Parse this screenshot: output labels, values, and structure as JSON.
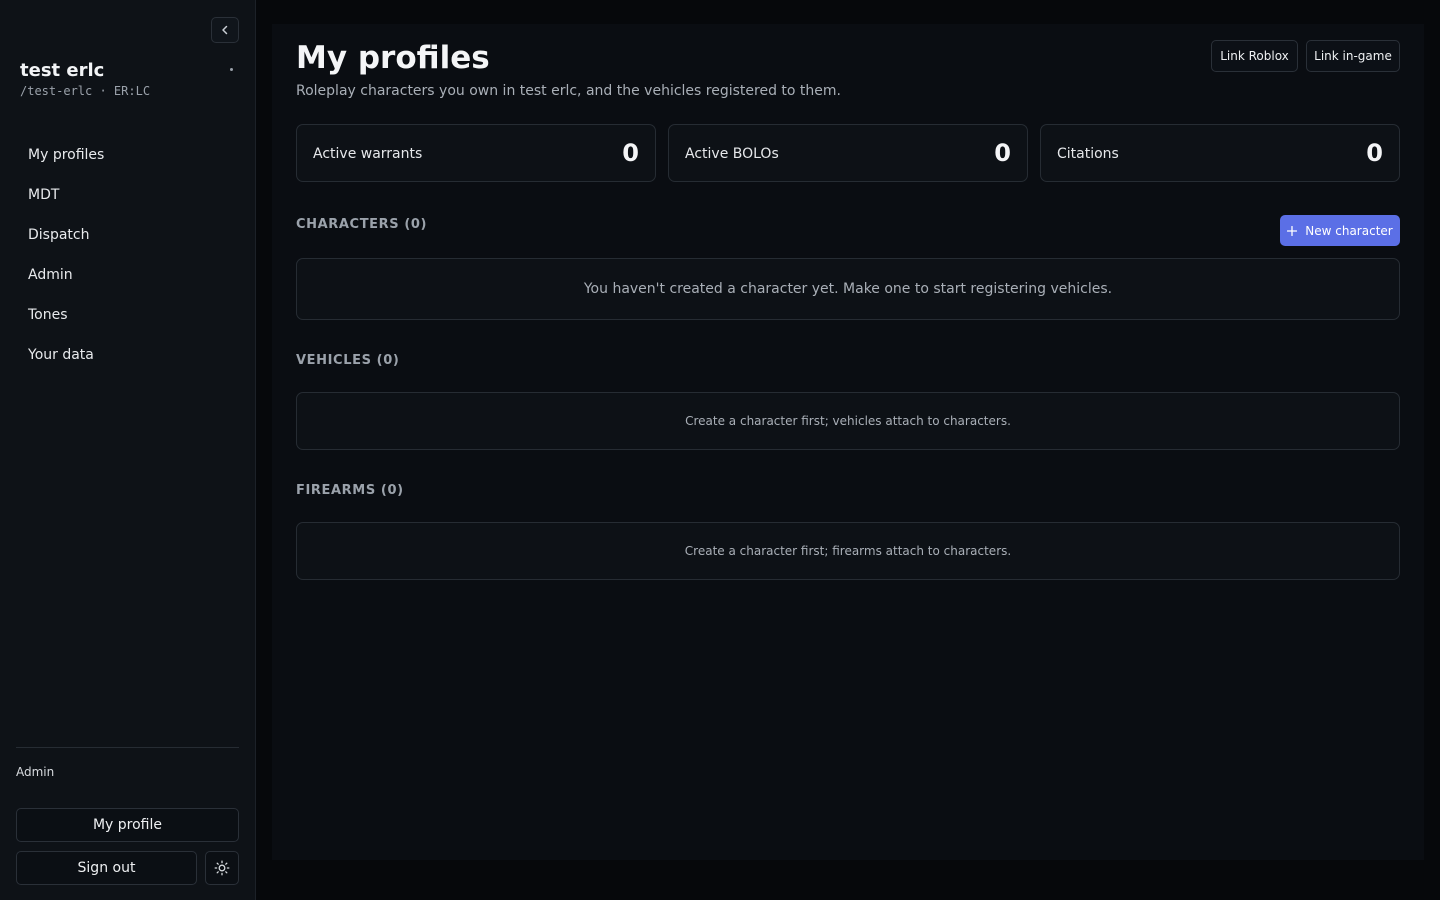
{
  "sidebar": {
    "server_name": "test erlc",
    "server_slug": "/test-erlc · ER:LC",
    "nav": [
      {
        "label": "My profiles"
      },
      {
        "label": "MDT"
      },
      {
        "label": "Dispatch"
      },
      {
        "label": "Admin"
      },
      {
        "label": "Tones"
      },
      {
        "label": "Your data"
      }
    ],
    "role": "Admin",
    "my_profile_label": "My profile",
    "sign_out_label": "Sign out"
  },
  "header": {
    "title": "My profiles",
    "subtitle": "Roleplay characters you own in test erlc, and the vehicles registered to them.",
    "link_roblox_label": "Link Roblox",
    "link_ingame_label": "Link in-game"
  },
  "stats": [
    {
      "label": "Active warrants",
      "value": "0"
    },
    {
      "label": "Active BOLOs",
      "value": "0"
    },
    {
      "label": "Citations",
      "value": "0"
    }
  ],
  "sections": {
    "characters": {
      "title": "CHARACTERS (0)",
      "new_button_label": "New character",
      "empty_text": "You haven't created a character yet. Make one to start registering vehicles."
    },
    "vehicles": {
      "title": "VEHICLES (0)",
      "empty_text": "Create a character first; vehicles attach to characters."
    },
    "firearms": {
      "title": "FIREARMS (0)",
      "empty_text": "Create a character first; firearms attach to characters."
    }
  },
  "colors": {
    "accent": "#5b6fe6",
    "background": "#06080b",
    "sidebar": "#0e1217",
    "panel": "#0a0d12"
  },
  "icons": {
    "collapse": "chevron-left-icon",
    "new_character": "plus-icon",
    "theme": "sun-icon"
  }
}
